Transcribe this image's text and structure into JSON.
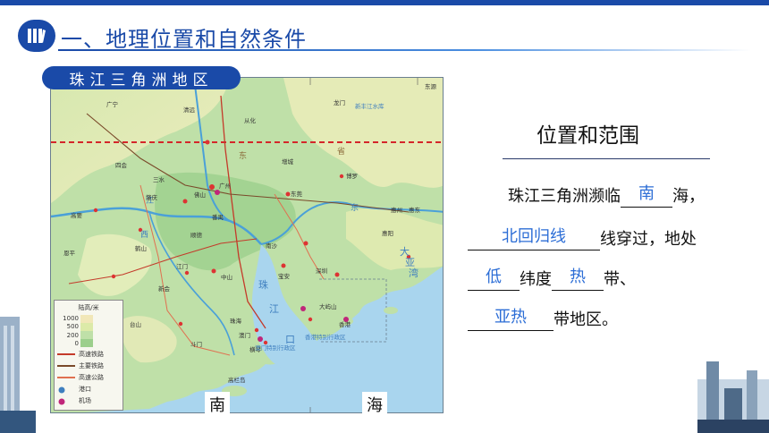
{
  "header": {
    "title": "一、地理位置和自然条件",
    "icon": "book-icon",
    "accent_color": "#1a4aa8"
  },
  "map": {
    "label": "珠江三角洲地区",
    "sea_left": "南",
    "sea_right": "海",
    "legend": {
      "title": "陆高/米",
      "elevations": [
        "1000",
        "500",
        "200",
        "0"
      ],
      "items": [
        "高速铁路",
        "主要铁路",
        "高速公路",
        "港口",
        "机场"
      ]
    },
    "places": [
      "广宁",
      "清远",
      "从化",
      "龙门",
      "东源",
      "新丰江水库",
      "四会",
      "广州",
      "增城",
      "惠州",
      "三水",
      "佛山",
      "东莞",
      "博罗",
      "高要",
      "肇庆",
      "鹤山",
      "江门",
      "中山",
      "深圳",
      "香港",
      "澳门",
      "珠海",
      "台山",
      "恩平",
      "新会",
      "惠东",
      "大亚湾",
      "惠阳",
      "宝安",
      "南沙",
      "番禺",
      "顺德",
      "横琴",
      "大屿山",
      "斗门",
      "高栏岛",
      "新兴",
      "香港特别行政区",
      "澳门特别行政区"
    ],
    "water_labels": [
      "珠江口",
      "西江",
      "北江",
      "东江",
      "大亚湾"
    ]
  },
  "side": {
    "heading": "位置和范围",
    "line1_before": "珠江三角洲濒临",
    "answer1": "南",
    "line1_after": "海，",
    "answer2": "北回归线",
    "line2_after": "线穿过，地处",
    "answer3": "低",
    "line3_mid": "纬度",
    "answer4": "热",
    "line3_after": "带、",
    "answer5": "亚热",
    "line4_after": "带地区。"
  }
}
